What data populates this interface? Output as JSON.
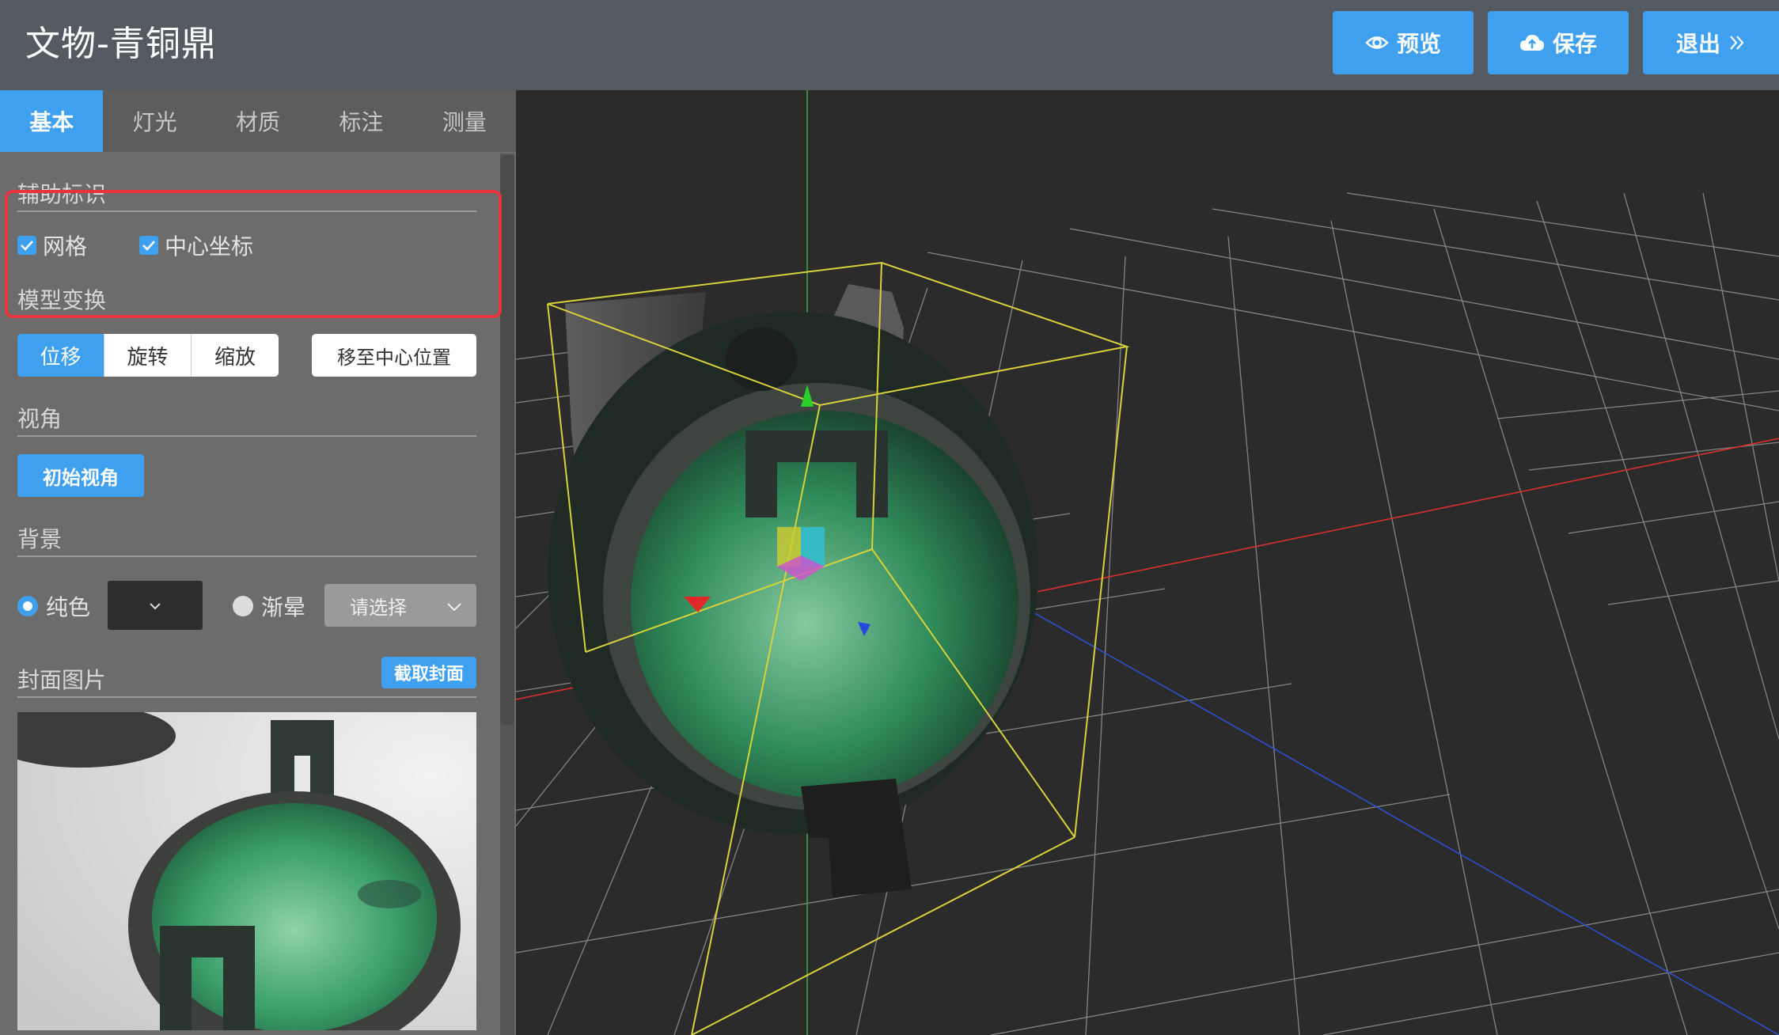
{
  "header": {
    "title": "文物-青铜鼎",
    "buttons": {
      "preview": "预览",
      "save": "保存",
      "exit": "退出"
    }
  },
  "tabs": [
    "基本",
    "灯光",
    "材质",
    "标注",
    "测量"
  ],
  "active_tab": "基本",
  "sections": {
    "aux": {
      "title": "辅助标识",
      "grid_label": "网格",
      "center_label": "中心坐标",
      "grid_checked": true,
      "center_checked": true
    },
    "transform": {
      "title": "模型变换",
      "modes": [
        "位移",
        "旋转",
        "缩放"
      ],
      "active_mode": "位移",
      "center_button": "移至中心位置"
    },
    "view": {
      "title": "视角",
      "initial_button": "初始视角"
    },
    "background": {
      "title": "背景",
      "solid_label": "纯色",
      "gradient_label": "渐晕",
      "select_placeholder": "请选择",
      "solid_selected": true,
      "solid_color": "#2d2d2d"
    },
    "cover": {
      "title": "封面图片",
      "capture_button": "截取封面"
    }
  },
  "icons": {
    "preview": "eye-icon",
    "save": "cloud-upload-icon",
    "exit": "double-chevron-right-icon"
  },
  "colors": {
    "accent": "#40a0f0",
    "highlight": "#e53340",
    "bbox": "#d8d23a"
  }
}
